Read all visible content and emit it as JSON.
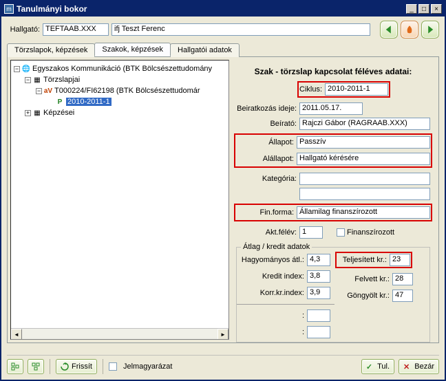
{
  "window": {
    "title": "Tanulmányi bokor"
  },
  "header": {
    "hallgato_label": "Hallgató:",
    "hallgato_code": "TEFTAAB.XXX",
    "hallgato_name": "ifj Teszt Ferenc"
  },
  "tabs": {
    "t1": "Törzslapok, képzések",
    "t2": "Szakok, képzések",
    "t3": "Hallgatói adatok"
  },
  "tree": {
    "n0": "Egyszakos Kommunikáció (BTK Bölcsészettudomány",
    "n1": "Törzslapjai",
    "n2_pre": "aV",
    "n2": "T000224/FI62198 (BTK Bölcsészettudomár",
    "n3_pre": "P",
    "n3": "2010-2011-1",
    "n4": "Képzései"
  },
  "section_title": "Szak - törzslap kapcsolat féléves adatai:",
  "form": {
    "ciklus_lbl": "Ciklus:",
    "ciklus": "2010-2011-1",
    "beir_lbl": "Beiratkozás ideje:",
    "beir": "2011.05.17.",
    "beirato_lbl": "Beírató:",
    "beirato": "Rajczi Gábor (RAGRAAB.XXX)",
    "allapot_lbl": "Állapot:",
    "allapot": "Passzív",
    "alallapot_lbl": "Alállapot:",
    "alallapot": "Hallgató kérésére",
    "kategoria_lbl": "Kategória:",
    "kategoria": "",
    "extra1": "",
    "finforma_lbl": "Fin.forma:",
    "finforma": "Államilag  finanszírozott",
    "aktfelev_lbl": "Akt.félév:",
    "aktfelev": "1",
    "finchk_lbl": "Finanszírozott"
  },
  "group": {
    "legend": "Átlag / kredit adatok",
    "hagy_lbl": "Hagyományos átl.:",
    "hagy": "4,3",
    "kredit_lbl": "Kredit index:",
    "kredit": "3,8",
    "korr_lbl": "Korr.kr.index:",
    "korr": "3,9",
    "empty_lbl": ":",
    "empty_lbl2": ":",
    "telj_lbl": "Teljesített kr.:",
    "telj": "23",
    "felv_lbl": "Felvett kr.:",
    "felv": "28",
    "gong_lbl": "Göngyölt kr.:",
    "gong": "47"
  },
  "bottom": {
    "frissit": "Frissít",
    "jelmagy": "Jelmagyarázat",
    "tul": "Tul.",
    "bezar": "Bezár"
  }
}
